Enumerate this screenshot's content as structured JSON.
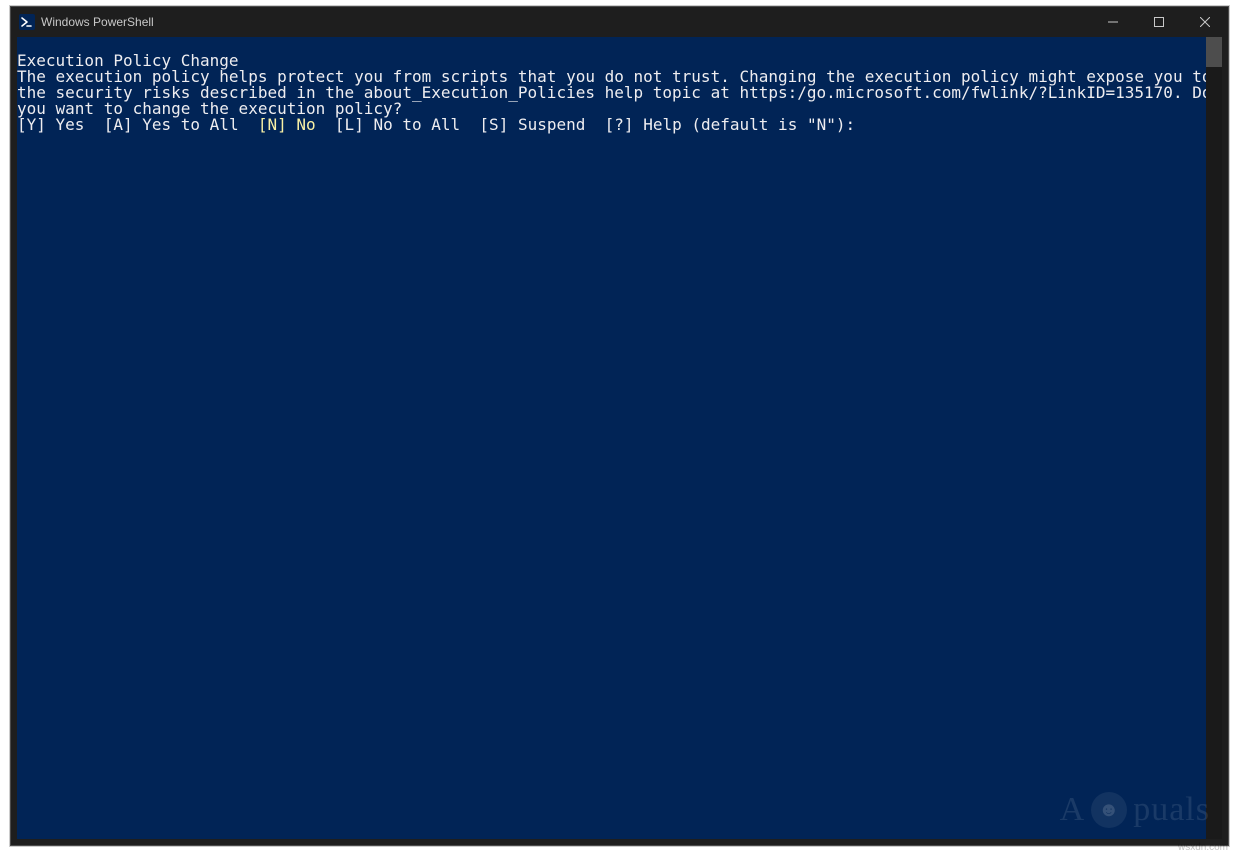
{
  "window": {
    "title": "Windows PowerShell"
  },
  "colors": {
    "terminal_bg": "#012456",
    "terminal_fg": "#eeedf0",
    "highlight": "#f9f1a5",
    "chrome": "#1e1e1e"
  },
  "terminal": {
    "heading": "Execution Policy Change",
    "body": "The execution policy helps protect you from scripts that you do not trust. Changing the execution policy might expose you to the security risks described in the about_Execution_Policies help topic at https:/go.microsoft.com/fwlink/?LinkID=135170. Do you want to change the execution policy?",
    "prompt": {
      "yes_key": "[Y]",
      "yes_label": " Yes  ",
      "all_key": "[A]",
      "all_label": " Yes to All  ",
      "no_key": "[N]",
      "no_label": " No  ",
      "noall_key": "[L]",
      "noall_label": " No to All  ",
      "suspend_key": "[S]",
      "suspend_label": " Suspend  ",
      "help_key": "[?]",
      "help_label": " Help (default is \"N\"):"
    }
  },
  "watermark": {
    "text": "A  puals",
    "sub": "wsxdn.com"
  }
}
